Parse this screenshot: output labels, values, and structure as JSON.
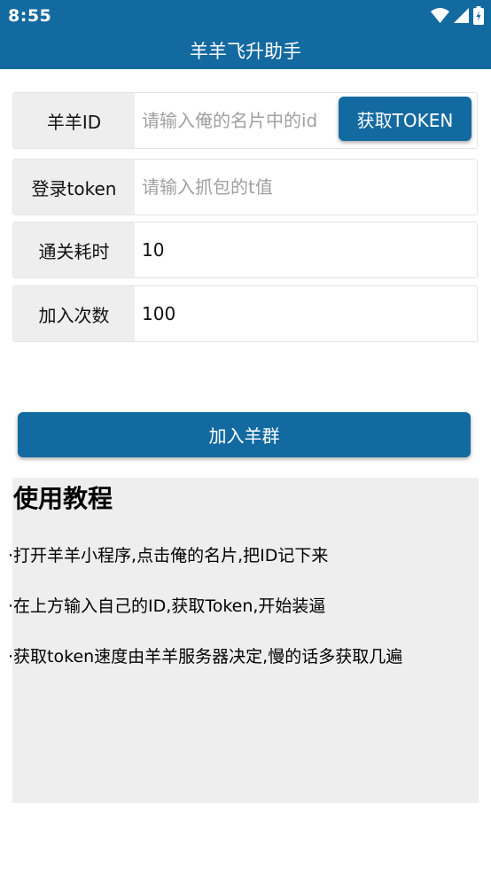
{
  "status_bar": {
    "time": "8:55",
    "icons": [
      "wifi-icon",
      "signal-icon",
      "battery-icon"
    ]
  },
  "app_bar": {
    "title": "羊羊飞升助手"
  },
  "form": {
    "id_row": {
      "label": "羊羊ID",
      "value": "",
      "placeholder": "请输入俺的名片中的id",
      "button_label": "获取TOKEN"
    },
    "token_row": {
      "label": "登录token",
      "value": "",
      "placeholder": "请输入抓包的t值"
    },
    "time_row": {
      "label": "通关耗时",
      "value": "10"
    },
    "count_row": {
      "label": "加入次数",
      "value": "100"
    }
  },
  "join_button_label": "加入羊群",
  "tutorial": {
    "title": "使用教程",
    "items": [
      "·打开羊羊小程序,点击俺的名片,把ID记下来",
      "·在上方输入自己的ID,获取Token,开始装逼",
      "·获取token速度由羊羊服务器决定,慢的话多获取几遍"
    ]
  },
  "colors": {
    "primary": "#136aa1",
    "label_bg": "#eeeeee",
    "panel_bg": "#eeeeee"
  }
}
